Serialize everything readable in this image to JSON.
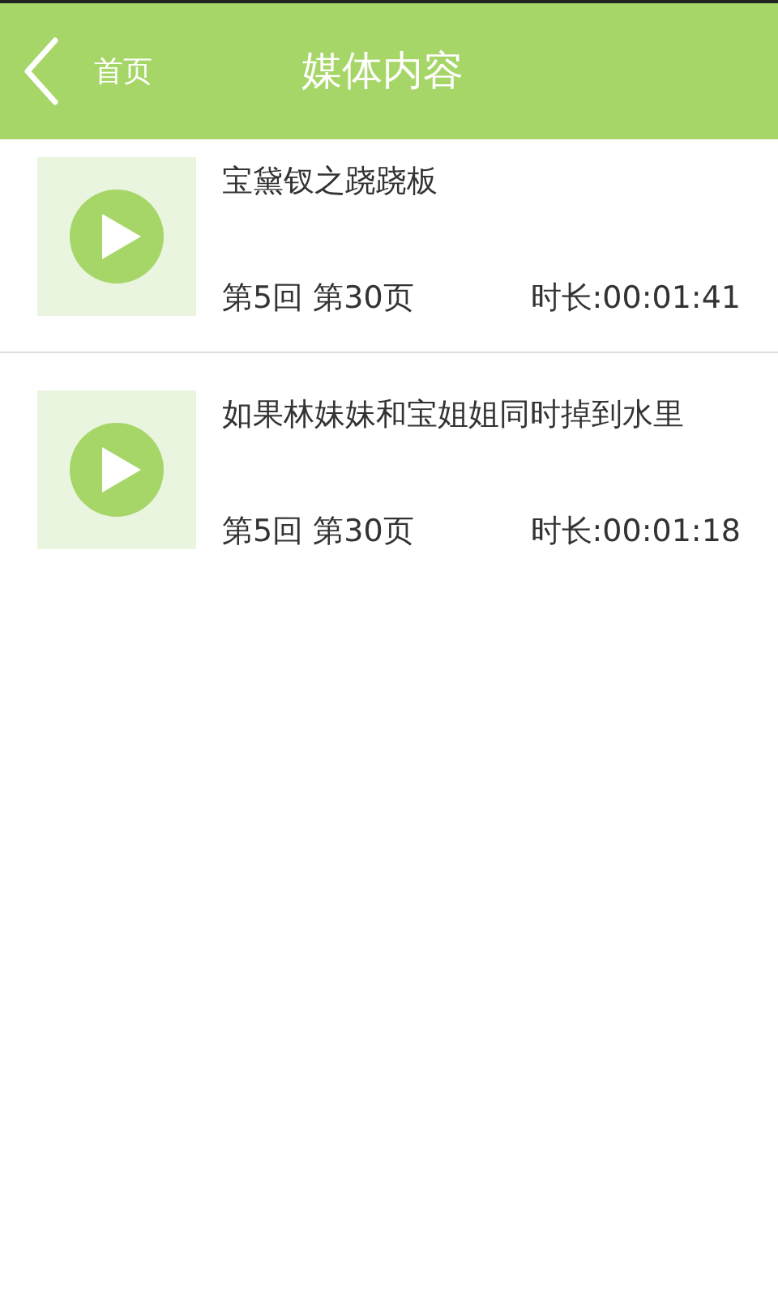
{
  "header": {
    "back_label": "首页",
    "title": "媒体内容"
  },
  "items": [
    {
      "title": "宝黛钗之跷跷板",
      "chapter": "第5回 第30页",
      "duration": "时长:00:01:41"
    },
    {
      "title": "如果林妹妹和宝姐姐同时掉到水里",
      "chapter": "第5回 第30页",
      "duration": "时长:00:01:18"
    }
  ]
}
